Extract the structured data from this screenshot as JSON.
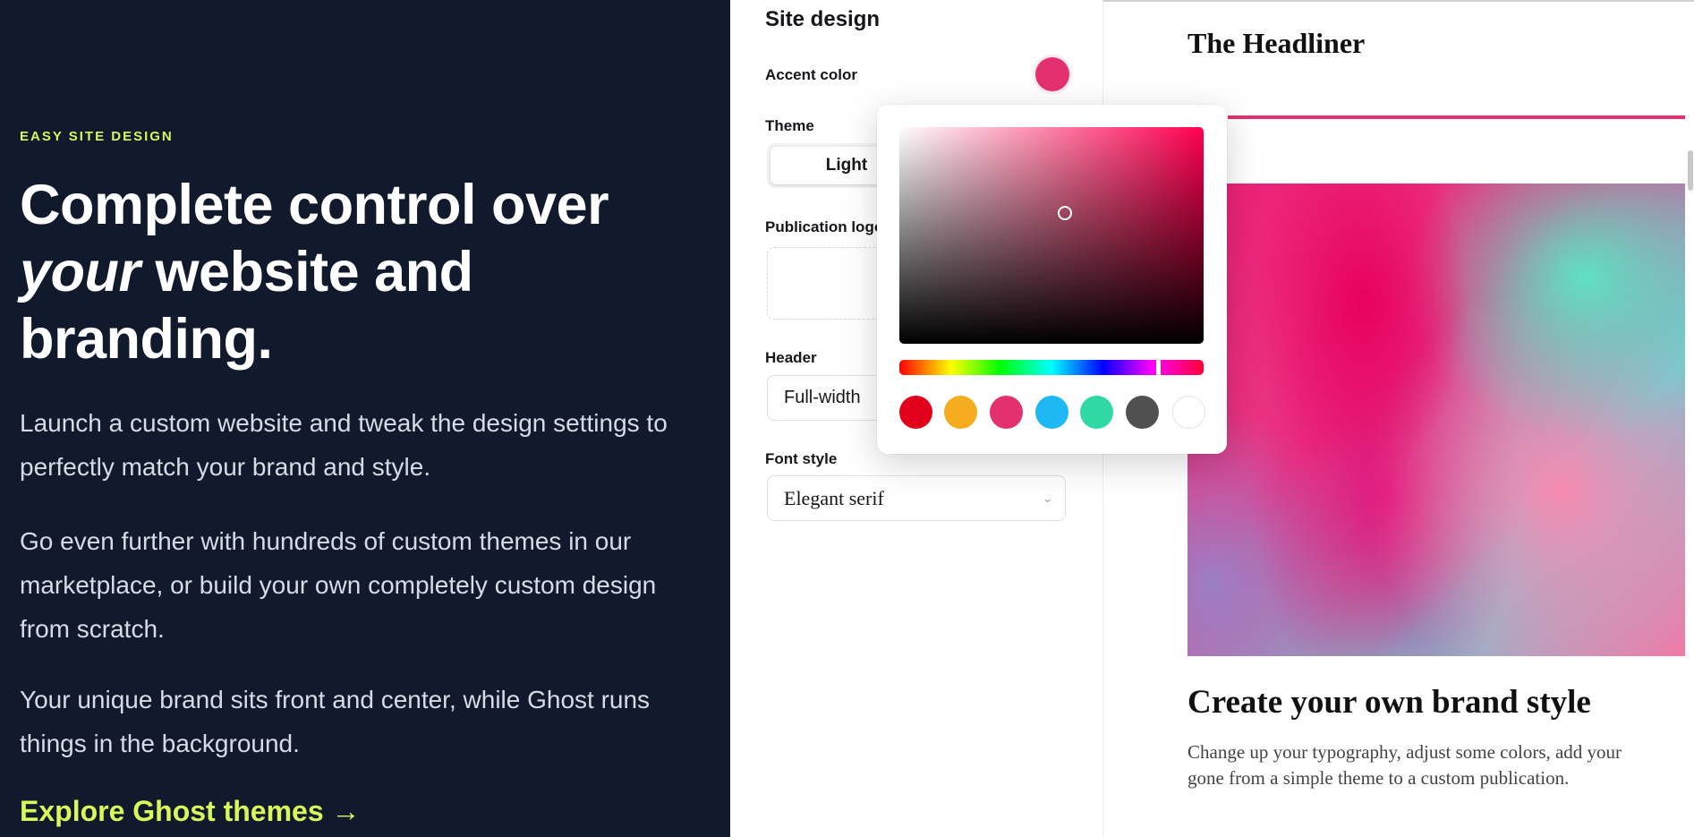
{
  "marketing": {
    "eyebrow": "EASY SITE DESIGN",
    "headline_pre": "Complete control over ",
    "headline_em": "your",
    "headline_post": " website and branding.",
    "paragraphs": [
      "Launch a custom website and tweak the design settings to perfectly match your brand and style.",
      "Go even further with hundreds of custom themes in our marketplace, or build your own completely custom design from scratch.",
      "Your unique brand sits front and center, while Ghost runs things in the background."
    ],
    "link": "Explore Ghost themes →"
  },
  "settings": {
    "title": "Site design",
    "accent_label": "Accent color",
    "accent_color": "#e3306f",
    "theme_label": "Theme",
    "theme_value": "Light",
    "logo_label": "Publication logo",
    "header_label": "Header",
    "header_value": "Full-width",
    "font_label": "Font style",
    "font_value": "Elegant serif",
    "font_chevron": "chevron-down-icon"
  },
  "color_picker": {
    "swatches": [
      "#e2001a",
      "#f5ac1e",
      "#e3306f",
      "#1eb8f5",
      "#30d9a4",
      "#505050",
      "#ffffff"
    ]
  },
  "preview": {
    "site_title": "The Headliner",
    "post_title": "Create your own brand style",
    "post_body_1": "Change up your typography, adjust some colors, add your",
    "post_body_2": "gone from a simple theme to a custom publication."
  }
}
